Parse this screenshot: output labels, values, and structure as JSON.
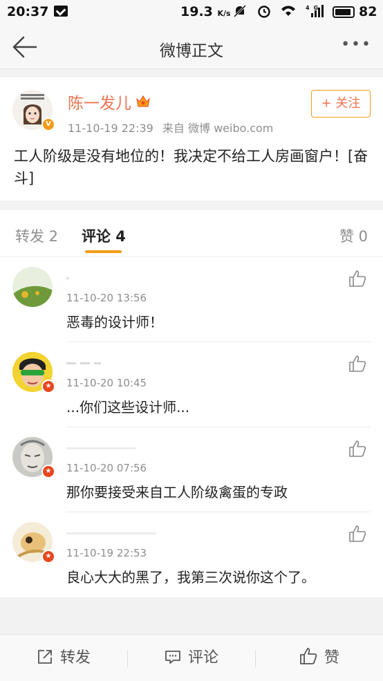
{
  "status_bar": {
    "time": "20:37",
    "speed": "19.3",
    "speed_unit": "K/s",
    "battery": "82"
  },
  "nav": {
    "title": "微博正文",
    "more": "•••"
  },
  "post": {
    "author": "陈一发儿",
    "timestamp": "11-10-19 22:39",
    "source": "来自 微博 weibo.com",
    "follow_label": "+ 关注",
    "content": "工人阶级是没有地位的！我决定不给工人房画窗户！[奋斗]"
  },
  "tabs": {
    "repost": "转发 2",
    "comment": "评论 4",
    "like": "赞 0"
  },
  "comments": [
    {
      "time": "11-10-20 13:56",
      "text": "恶毒的设计师！"
    },
    {
      "time": "11-10-20 10:45",
      "text": "...你们这些设计师..."
    },
    {
      "time": "11-10-20 07:56",
      "text": "那你要接受来自工人阶级禽蛋的专政"
    },
    {
      "time": "11-10-19 22:53",
      "text": "良心大大的黑了，我第三次说你这个了。"
    }
  ],
  "bottom_bar": {
    "repost": "转发",
    "comment": "评论",
    "like": "赞"
  },
  "colors": {
    "accent": "#eb7350",
    "tab_underline": "#f59b16"
  }
}
